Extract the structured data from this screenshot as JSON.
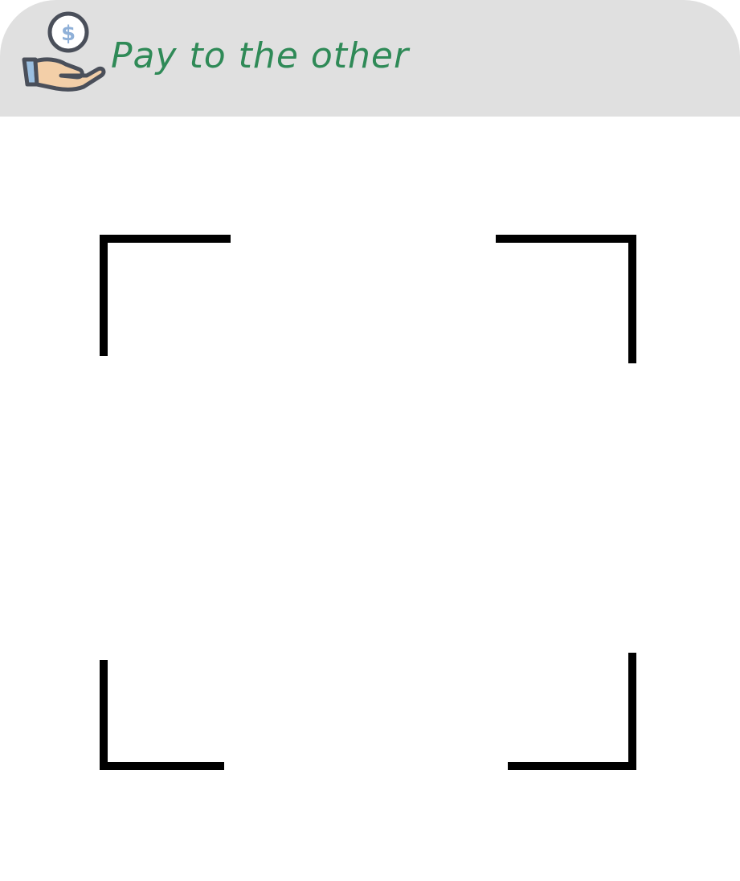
{
  "header": {
    "title": "Pay to the other",
    "icon": "hand-coin-icon",
    "coin_symbol": "$",
    "title_color": "#2f8a57",
    "background_color": "#e0e0e0"
  },
  "scanner": {
    "frame_color": "#000000",
    "corners": [
      "top-left",
      "top-right",
      "bottom-left",
      "bottom-right"
    ]
  }
}
